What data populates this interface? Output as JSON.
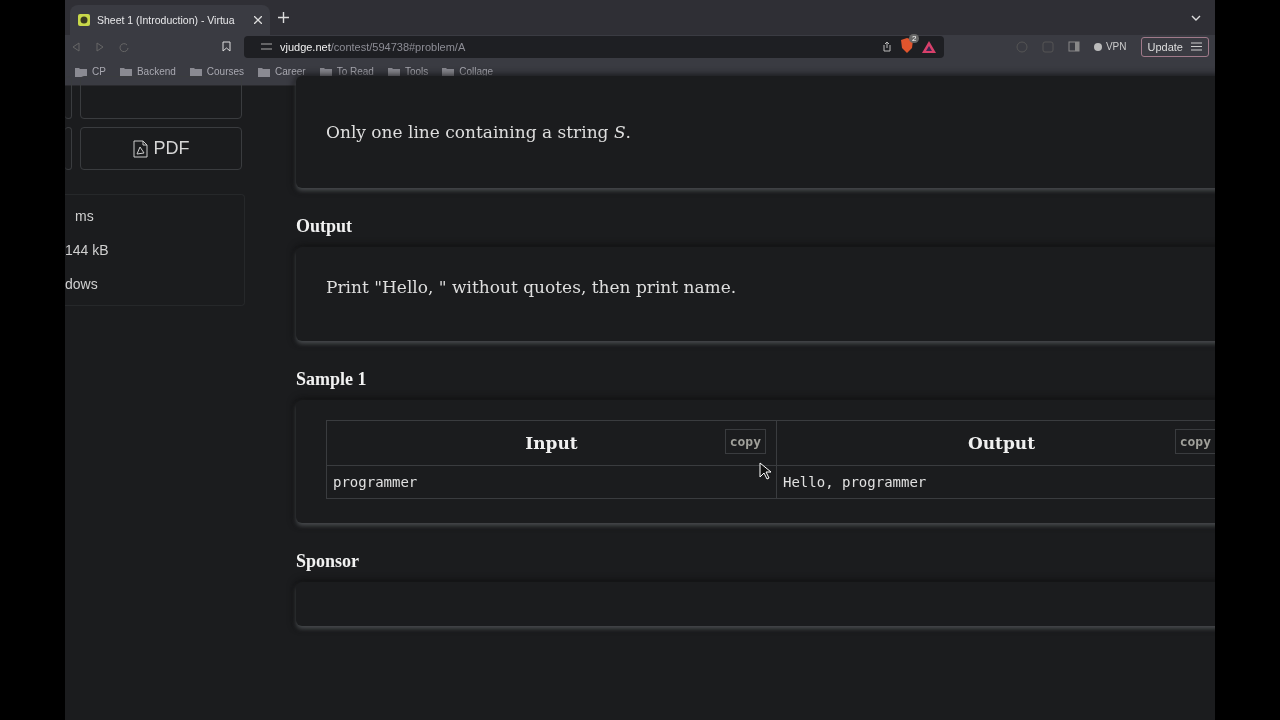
{
  "browser": {
    "tab": {
      "title": "Sheet 1 (Introduction) - Virtua",
      "selected": true
    },
    "address": {
      "host": "vjudge.net",
      "path": "/contest/594738#problem/A"
    },
    "shield_count": "2",
    "vpn": "VPN",
    "update": "Update",
    "bookmarks": [
      "CP",
      "Backend",
      "Courses",
      "Career",
      "To Read",
      "Tools",
      "Collage"
    ]
  },
  "sidebar": {
    "pdf_button": "PDF",
    "info": [
      "ms",
      "144 kB",
      "dows"
    ]
  },
  "problem": {
    "input_text": "Only one line containing a string *S*.",
    "sections": [
      {
        "kind": "text",
        "heading": "Output",
        "body": "Print \"Hello, \" without quotes, then print name."
      },
      {
        "kind": "sample",
        "heading": "Sample 1",
        "columns": [
          {
            "title": "Input",
            "copy": "copy",
            "value": "programmer"
          },
          {
            "title": "Output",
            "copy": "copy",
            "value": "Hello, programmer"
          }
        ]
      },
      {
        "kind": "empty",
        "heading": "Sponsor"
      }
    ]
  }
}
